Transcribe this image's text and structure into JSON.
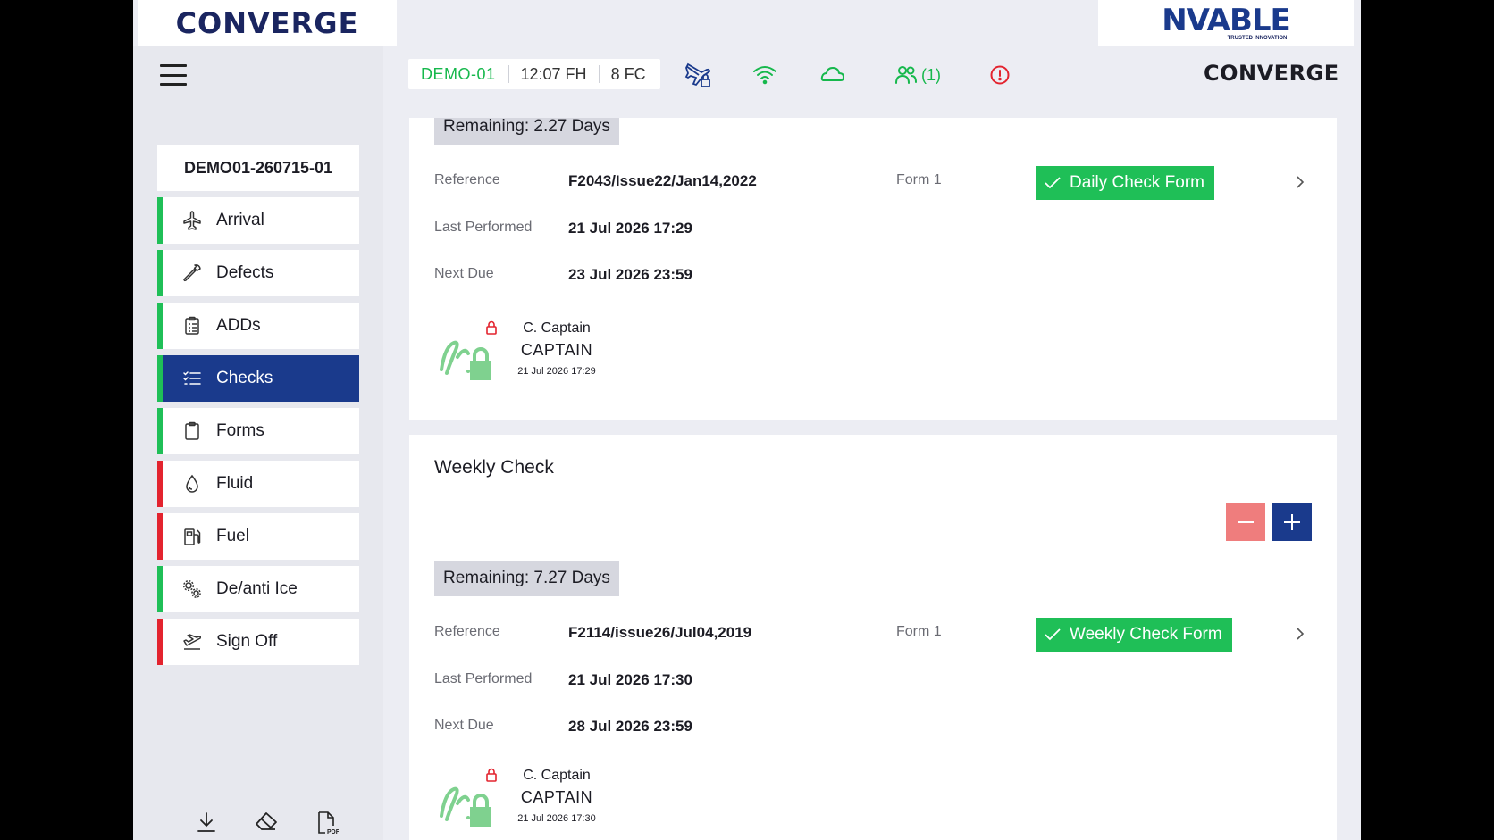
{
  "header": {
    "logo_left": "CONVERGE",
    "logo_right": "NVABLE",
    "logo_right_tagline": "TRUSTED INNOVATION",
    "aircraft": "DEMO-01",
    "flight_hours": "12:07 FH",
    "flight_cycles": "8 FC",
    "users_count": "(1)",
    "brand_right": "CONVERGE"
  },
  "sidebar": {
    "flight_id": "DEMO01-260715-01",
    "items": [
      {
        "label": "Arrival",
        "icon": "airplane-icon",
        "status": "green"
      },
      {
        "label": "Defects",
        "icon": "wrench-icon",
        "status": "green"
      },
      {
        "label": "ADDs",
        "icon": "clipboard-list-icon",
        "status": "green"
      },
      {
        "label": "Checks",
        "icon": "checklist-icon",
        "status": "green",
        "active": true
      },
      {
        "label": "Forms",
        "icon": "clipboard-icon",
        "status": "green"
      },
      {
        "label": "Fluid",
        "icon": "droplet-icon",
        "status": "red"
      },
      {
        "label": "Fuel",
        "icon": "fuel-pump-icon",
        "status": "red"
      },
      {
        "label": "De/anti Ice",
        "icon": "gears-icon",
        "status": "green"
      },
      {
        "label": "Sign Off",
        "icon": "takeoff-icon",
        "status": "red"
      }
    ]
  },
  "daily_check": {
    "remaining": "Remaining: 2.27 Days",
    "reference_label": "Reference",
    "reference": "F2043/Issue22/Jan14,2022",
    "form_label": "Form 1",
    "form_button": "Daily Check Form",
    "last_performed_label": "Last Performed",
    "last_performed": "21 Jul 2026 17:29",
    "next_due_label": "Next Due",
    "next_due": "23 Jul 2026 23:59",
    "signer_name": "C. Captain",
    "signer_role": "CAPTAIN",
    "signed_at": "21 Jul 2026 17:29"
  },
  "weekly_check": {
    "title": "Weekly Check",
    "remaining": "Remaining: 7.27 Days",
    "reference_label": "Reference",
    "reference": "F2114/issue26/Jul04,2019",
    "form_label": "Form 1",
    "form_button": "Weekly Check Form",
    "last_performed_label": "Last Performed",
    "last_performed": "21 Jul 2026 17:30",
    "next_due_label": "Next Due",
    "next_due": "28 Jul 2026 23:59",
    "signer_name": "C. Captain",
    "signer_role": "CAPTAIN",
    "signed_at": "21 Jul 2026 17:30"
  },
  "colors": {
    "accent_green": "#1fbf57",
    "brand_blue": "#1a3a8c",
    "alert_red": "#e3232e"
  }
}
